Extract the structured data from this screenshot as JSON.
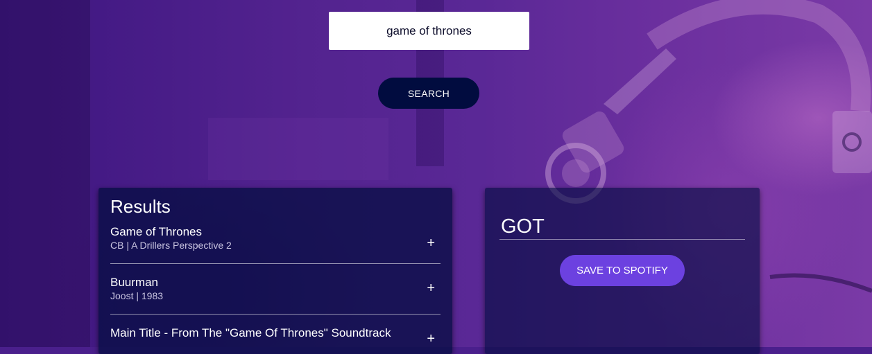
{
  "search": {
    "value": "game of thrones",
    "button_label": "SEARCH"
  },
  "results": {
    "title": "Results",
    "add_symbol": "+",
    "tracks": [
      {
        "name": "Game of Thrones",
        "info": "CB | A Drillers Perspective 2"
      },
      {
        "name": "Buurman",
        "info": "Joost | 1983"
      },
      {
        "name": "Main Title - From The \"Game Of Thrones\" Soundtrack",
        "info": ""
      }
    ]
  },
  "playlist": {
    "name": "GOT",
    "save_label": "SAVE TO SPOTIFY"
  },
  "colors": {
    "background": "#4a1f8c",
    "search_button": "#010c3f",
    "panel": "#010c3f",
    "save_button": "#6c41e0"
  }
}
